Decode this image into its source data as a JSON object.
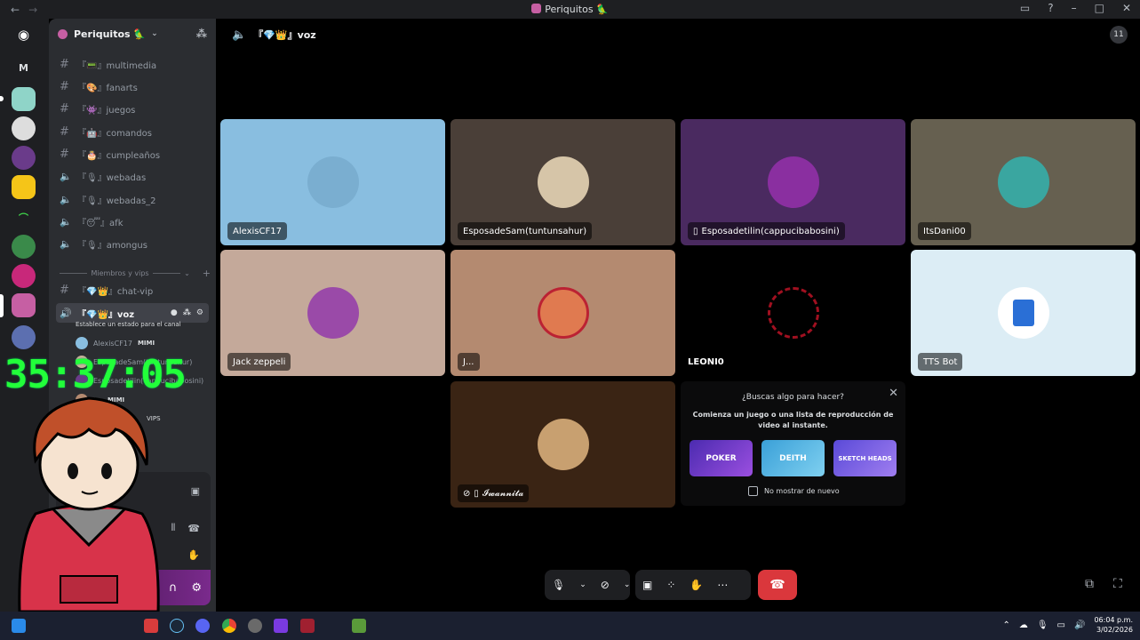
{
  "window": {
    "title": "Periquitos 🦜",
    "back_icon": "arrow-left",
    "forward_icon": "arrow-right"
  },
  "titlebar_controls": [
    "inbox-icon",
    "help-icon",
    "minimize",
    "maximize",
    "close"
  ],
  "rail": {
    "dm_label": "M"
  },
  "server": {
    "name": "Periquitos 🦜"
  },
  "channels": [
    {
      "type": "text",
      "label": "『📟』multimedia"
    },
    {
      "type": "text",
      "label": "『🎨』fanarts"
    },
    {
      "type": "text",
      "label": "『👾』juegos"
    },
    {
      "type": "text",
      "label": "『🤖』comandos"
    },
    {
      "type": "text",
      "label": "『🎂』cumpleaños"
    },
    {
      "type": "voice",
      "label": "『🎙』webadas"
    },
    {
      "type": "voice",
      "label": "『🎙』webadas_2"
    },
    {
      "type": "voice",
      "label": "『😴』afk"
    },
    {
      "type": "voice",
      "label": "『🎙』amongus"
    }
  ],
  "category": {
    "label": "Miembros y vips"
  },
  "vip_channels": [
    {
      "type": "text",
      "label": "『💎👑』chat-vip"
    },
    {
      "type": "voice",
      "label": "『💎👑』voz"
    }
  ],
  "status_tip": "Establece un estado para el canal",
  "voice_users": [
    {
      "name": "AlexisCF17",
      "tag": "MIMI"
    },
    {
      "name": "EsposadeSam(tuntunsahur)",
      "tag": ""
    },
    {
      "name": "Esposadetilin(cappucibabosini)",
      "tag": ""
    },
    {
      "name": "J...",
      "tag": "MIMI"
    },
    {
      "name": "",
      "tag": "VIPS"
    }
  ],
  "timer": "35:37:05",
  "call": {
    "channel_label": "『💎👑』voz",
    "participants_count": "11"
  },
  "tiles": [
    {
      "name": "AlexisCF17",
      "bg": "#89bee0"
    },
    {
      "name": "EsposadeSam(tuntunsahur)",
      "bg": "#4a3f38"
    },
    {
      "name": "Esposadetilin(cappucibabosini)",
      "bg": "#4a2a60",
      "mobile": true
    },
    {
      "name": "ItsDani00",
      "bg": "#666050"
    },
    {
      "name": "Jack zeppeli",
      "bg": "#c4a99a"
    },
    {
      "name": "J...",
      "bg": "#b48a70"
    },
    {
      "name": "LEONI0",
      "bg": "#000000"
    },
    {
      "name": "TTS Bot",
      "bg": "#dcedf5"
    },
    {
      "name": "𝓘𝔀𝓪𝓷𝓷𝓲𝓽𝓪",
      "bg": "#3a2414",
      "mobile": true,
      "muted": true
    }
  ],
  "activity": {
    "question": "¿Buscas algo para hacer?",
    "description": "Comienza un juego o una lista de reproducción de video al instante.",
    "games": [
      "POKER",
      "DEITH",
      "SKETCH HEADS"
    ],
    "dont_show": "No mostrar de nuevo"
  },
  "taskbar": {
    "time": "06:04 p.m.",
    "date": "3/02/2026"
  },
  "colors": {
    "hangup": "#da373c",
    "timer": "#22ff3a",
    "accent": "#5865f2"
  }
}
